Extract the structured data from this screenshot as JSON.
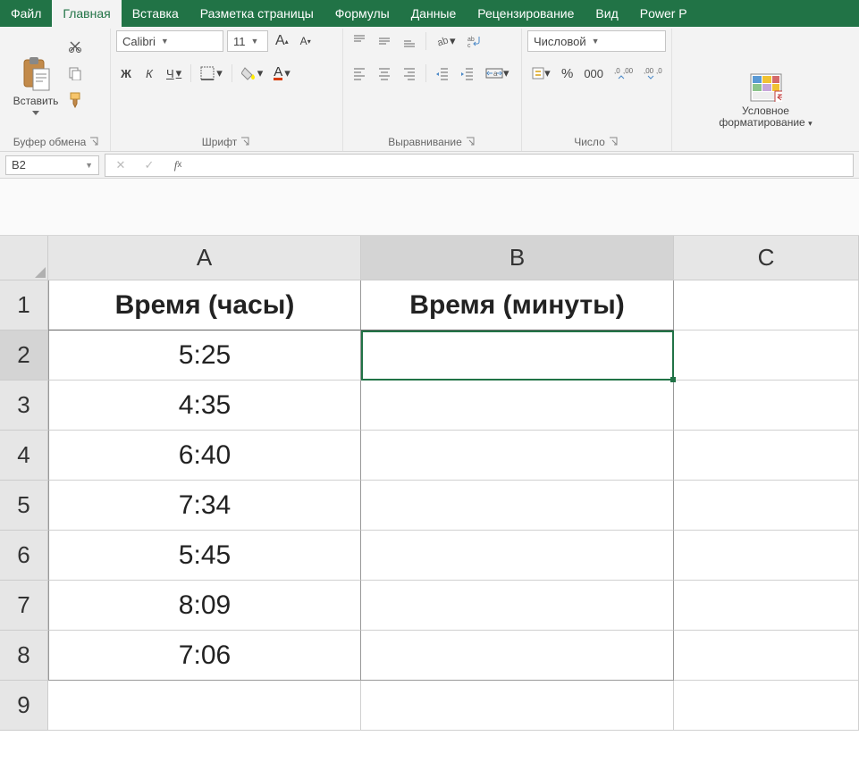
{
  "tabs": {
    "file": "Файл",
    "home": "Главная",
    "insert": "Вставка",
    "pagelayout": "Разметка страницы",
    "formulas": "Формулы",
    "data": "Данные",
    "review": "Рецензирование",
    "view": "Вид",
    "powerp": "Power P"
  },
  "ribbon": {
    "clipboard": {
      "paste": "Вставить",
      "label": "Буфер обмена"
    },
    "font": {
      "name": "Calibri",
      "size": "11",
      "bold": "Ж",
      "italic": "К",
      "underline": "Ч",
      "label": "Шрифт"
    },
    "alignment": {
      "label": "Выравнивание"
    },
    "number": {
      "format": "Числовой",
      "label": "Число"
    },
    "styles": {
      "cond1": "Условное",
      "cond2": "форматирование"
    },
    "increaseA": "A",
    "decreaseA": "A"
  },
  "namebox": "B2",
  "columns": {
    "A": "A",
    "B": "B",
    "C": "C"
  },
  "rows": [
    "1",
    "2",
    "3",
    "4",
    "5",
    "6",
    "7",
    "8",
    "9"
  ],
  "data": {
    "A1": "Время (часы)",
    "B1": "Время (минуты)",
    "A2": "5:25",
    "A3": "4:35",
    "A4": "6:40",
    "A5": "7:34",
    "A6": "5:45",
    "A7": "8:09",
    "A8": "7:06"
  },
  "colWidths": {
    "A": 350,
    "B": 350,
    "C": 207
  }
}
